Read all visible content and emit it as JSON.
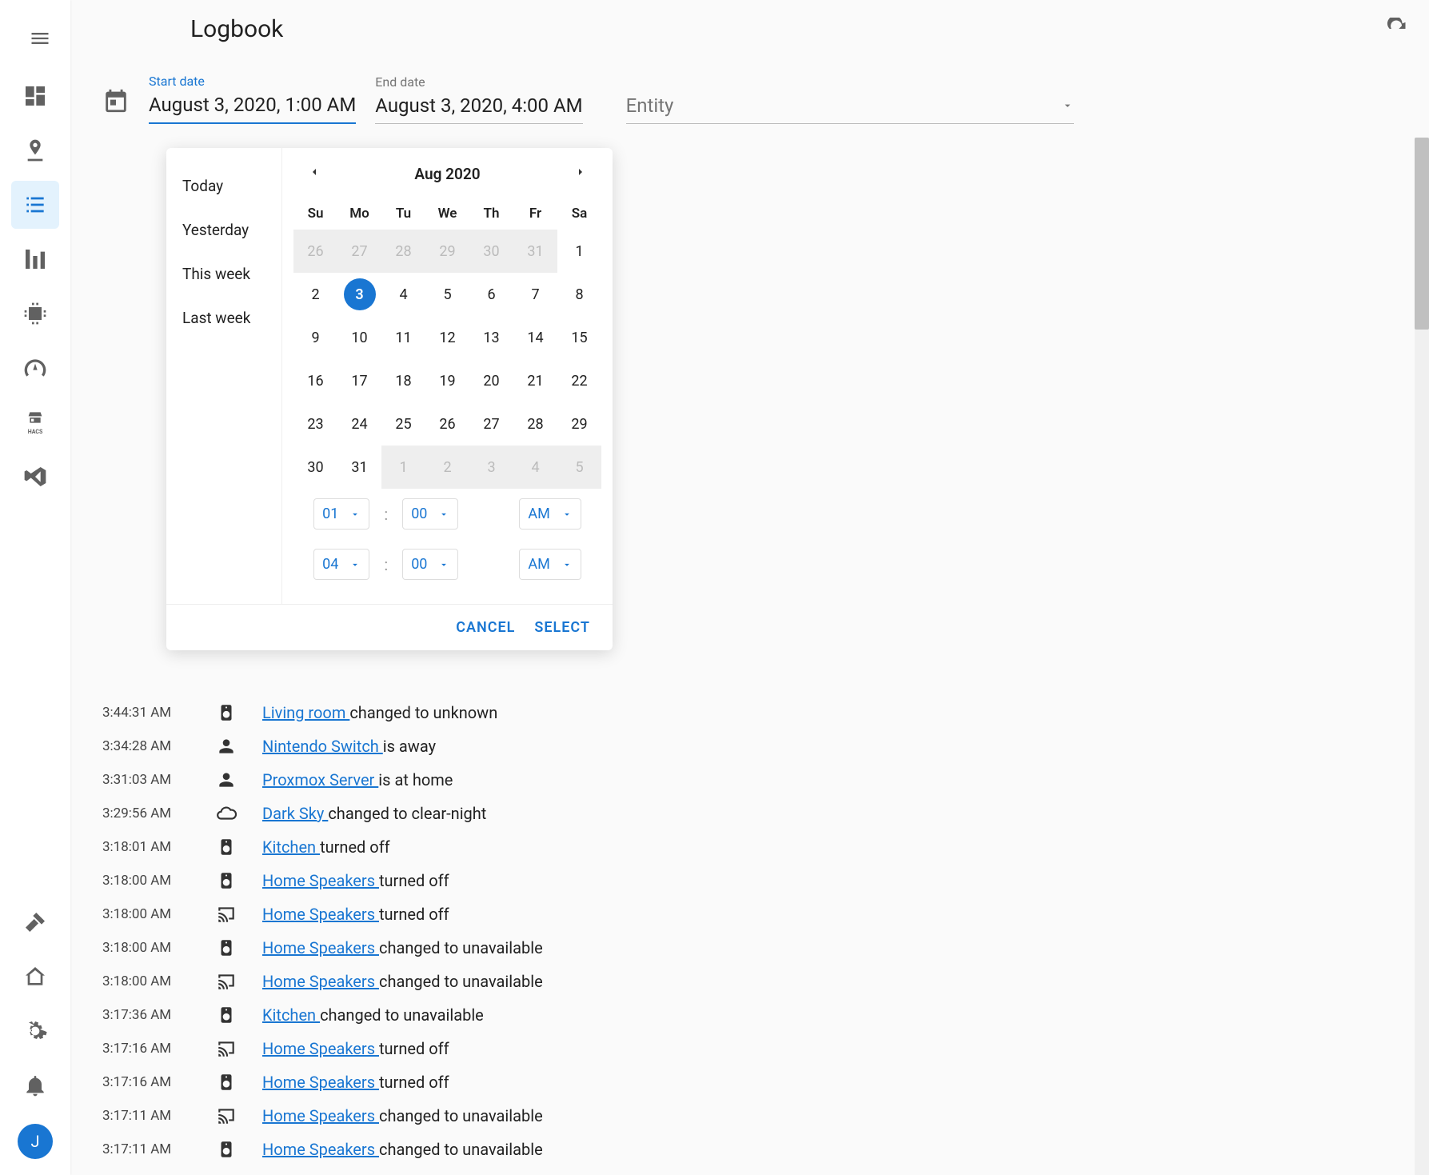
{
  "header": {
    "title": "Logbook"
  },
  "avatar_initial": "J",
  "filters": {
    "start_label": "Start date",
    "start_value": "August 3, 2020, 1:00 AM",
    "end_label": "End date",
    "end_value": "August 3, 2020, 4:00 AM",
    "entity_label": "Entity"
  },
  "datepicker": {
    "presets": [
      "Today",
      "Yesterday",
      "This week",
      "Last week"
    ],
    "month_label": "Aug 2020",
    "dow": [
      "Su",
      "Mo",
      "Tu",
      "We",
      "Th",
      "Fr",
      "Sa"
    ],
    "prev_days": [
      "26",
      "27",
      "28",
      "29",
      "30",
      "31"
    ],
    "days": [
      "1",
      "2",
      "3",
      "4",
      "5",
      "6",
      "7",
      "8",
      "9",
      "10",
      "11",
      "12",
      "13",
      "14",
      "15",
      "16",
      "17",
      "18",
      "19",
      "20",
      "21",
      "22",
      "23",
      "24",
      "25",
      "26",
      "27",
      "28",
      "29",
      "30",
      "31"
    ],
    "next_days": [
      "1",
      "2",
      "3",
      "4",
      "5"
    ],
    "selected_day": "3",
    "time1": {
      "hour": "01",
      "min": "00",
      "ampm": "AM"
    },
    "time2": {
      "hour": "04",
      "min": "00",
      "ampm": "AM"
    },
    "cancel": "CANCEL",
    "select": "SELECT"
  },
  "log": [
    {
      "time": "3:44:31 AM",
      "icon": "speaker",
      "entity": "Living room",
      "text": "changed to unknown"
    },
    {
      "time": "3:34:28 AM",
      "icon": "person",
      "entity": "Nintendo Switch",
      "text": "is away"
    },
    {
      "time": "3:31:03 AM",
      "icon": "person",
      "entity": "Proxmox Server",
      "text": "is at home"
    },
    {
      "time": "3:29:56 AM",
      "icon": "cloud",
      "entity": "Dark Sky",
      "text": "changed to clear-night"
    },
    {
      "time": "3:18:01 AM",
      "icon": "speaker",
      "entity": "Kitchen",
      "text": "turned off"
    },
    {
      "time": "3:18:00 AM",
      "icon": "speaker",
      "entity": "Home Speakers",
      "text": "turned off"
    },
    {
      "time": "3:18:00 AM",
      "icon": "cast",
      "entity": "Home Speakers",
      "text": "turned off"
    },
    {
      "time": "3:18:00 AM",
      "icon": "speaker",
      "entity": "Home Speakers",
      "text": "changed to unavailable"
    },
    {
      "time": "3:18:00 AM",
      "icon": "cast",
      "entity": "Home Speakers",
      "text": "changed to unavailable"
    },
    {
      "time": "3:17:36 AM",
      "icon": "speaker",
      "entity": "Kitchen",
      "text": "changed to unavailable"
    },
    {
      "time": "3:17:16 AM",
      "icon": "cast",
      "entity": "Home Speakers",
      "text": "turned off"
    },
    {
      "time": "3:17:16 AM",
      "icon": "speaker",
      "entity": "Home Speakers",
      "text": "turned off"
    },
    {
      "time": "3:17:11 AM",
      "icon": "cast",
      "entity": "Home Speakers",
      "text": "changed to unavailable"
    },
    {
      "time": "3:17:11 AM",
      "icon": "speaker",
      "entity": "Home Speakers",
      "text": "changed to unavailable"
    }
  ]
}
